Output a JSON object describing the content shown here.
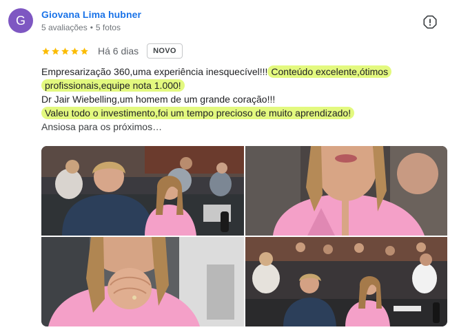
{
  "reviewer": {
    "initial": "G",
    "avatar_color": "#7e57c2",
    "name": "Giovana Lima hubner",
    "reviews_count": "5 avaliações",
    "separator": "•",
    "photos_count": "5 fotos"
  },
  "review": {
    "rating": 5,
    "max_rating": 5,
    "star_color": "#fbbc04",
    "time_ago": "Há 6 dias",
    "badge": "NOVO",
    "line1_plain": "Empresarização 360,uma experiência inesquecível!!!",
    "line1_hl": "Conteúdo excelente,ótimos",
    "line2_hl": "profissionais,equipe nota 1.000!",
    "line3_plain": "Dr Jair Wiebelling,um homem de um grande coração!!!",
    "line4_hl": "Valeu todo o investimento,foi um tempo precioso de muito aprendizado!",
    "line5_plain": "Ansiosa para os próximos…",
    "highlight_color": "#e3f97f"
  },
  "photos": {
    "count": 4,
    "accent_color": "#f4a0c8"
  },
  "icons": {
    "report": "report-flag-icon",
    "star": "star-icon"
  }
}
